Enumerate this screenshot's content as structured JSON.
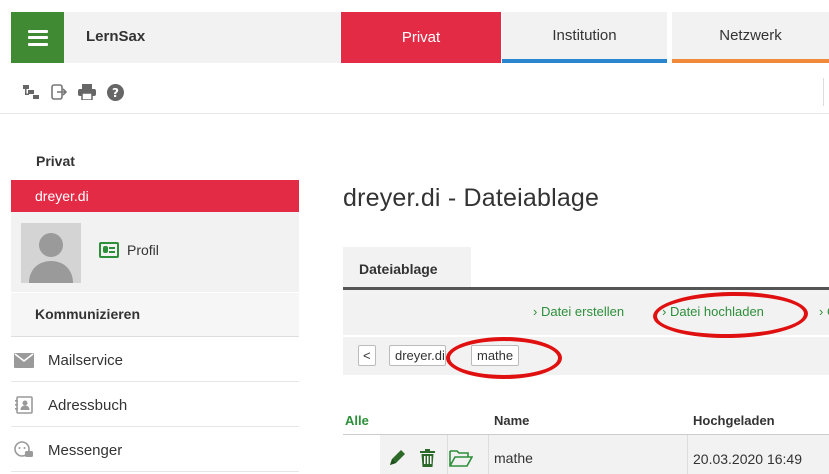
{
  "topbar": {
    "brand": "LernSax",
    "tabs": [
      {
        "label": "Privat"
      },
      {
        "label": "Institution"
      },
      {
        "label": "Netzwerk"
      }
    ]
  },
  "toolbar": {
    "icons": [
      "sitemap-icon",
      "logout-icon",
      "print-icon",
      "help-icon"
    ]
  },
  "sidebar": {
    "title": "Privat",
    "user": "dreyer.di",
    "profile_label": "Profil",
    "section": "Kommunizieren",
    "items": [
      {
        "label": "Mailservice",
        "icon": "mail-icon"
      },
      {
        "label": "Adressbuch",
        "icon": "addressbook-icon"
      },
      {
        "label": "Messenger",
        "icon": "messenger-icon"
      }
    ]
  },
  "main": {
    "title": "dreyer.di - Dateiablage",
    "tab": "Dateiablage",
    "actions": [
      "Datei erstellen",
      "Datei hochladen",
      "O"
    ],
    "breadcrumb": {
      "back": "<",
      "home": "dreyer.di",
      "current": "mathe"
    },
    "table": {
      "headers": {
        "select": "Alle",
        "name": "Name",
        "uploaded": "Hochgeladen"
      },
      "rows": [
        {
          "name": "mathe",
          "uploaded": "20.03.2020 16:49"
        }
      ]
    }
  },
  "colors": {
    "brand_green": "#3f8a32",
    "privat_red": "#e32b46",
    "institution_blue": "#2a86cf",
    "netzwerk_orange": "#f0893a",
    "link_green": "#2d8f3a",
    "annotation_red": "#e01010"
  }
}
